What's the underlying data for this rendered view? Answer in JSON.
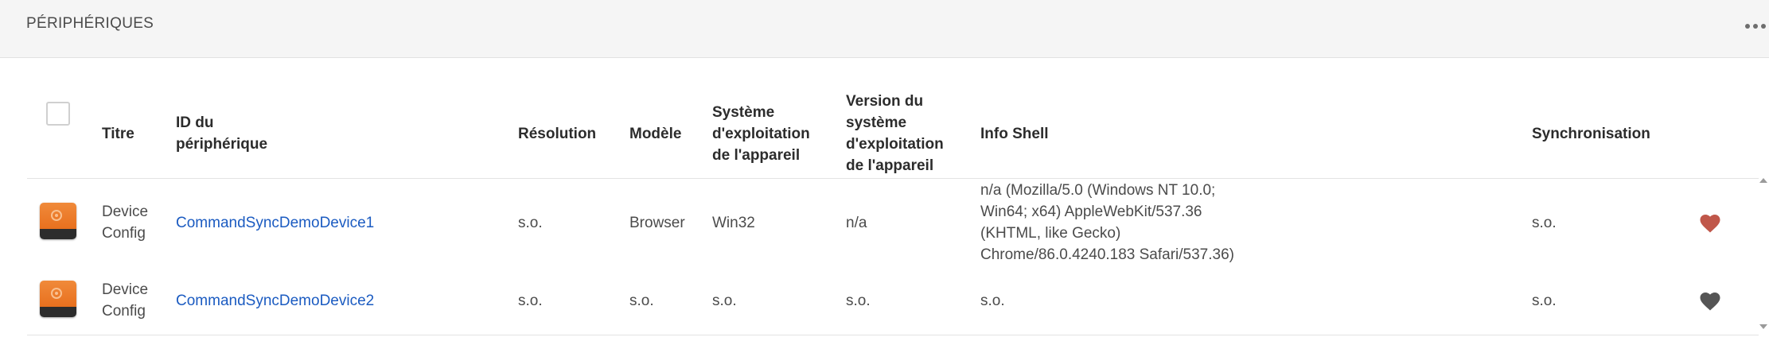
{
  "header": {
    "title": "PÉRIPHÉRIQUES"
  },
  "table": {
    "columns": {
      "title": "Titre",
      "device_id": "ID du\npériphérique",
      "resolution": "Résolution",
      "model": "Modèle",
      "os": "Système\nd'exploitation\nde l'appareil",
      "os_version": "Version du\nsystème\nd'exploitation\nde l'appareil",
      "shell_info": "Info Shell",
      "sync": "Synchronisation"
    },
    "rows": [
      {
        "title": "Device\nConfig",
        "device_id": "CommandSyncDemoDevice1",
        "resolution": "s.o.",
        "model": "Browser",
        "os": "Win32",
        "os_version": "n/a",
        "shell_info": "n/a (Mozilla/5.0 (Windows NT 10.0;\nWin64; x64) AppleWebKit/537.36\n(KHTML, like Gecko)\nChrome/86.0.4240.183 Safari/537.36)",
        "sync": "s.o.",
        "heart_color": "#c0574a"
      },
      {
        "title": "Device\nConfig",
        "device_id": "CommandSyncDemoDevice2",
        "resolution": "s.o.",
        "model": "s.o.",
        "os": "s.o.",
        "os_version": "s.o.",
        "shell_info": "s.o.",
        "sync": "s.o.",
        "heart_color": "#555555"
      }
    ]
  },
  "colors": {
    "link": "#1b5bc1",
    "accent_orange": "#e8701e"
  }
}
